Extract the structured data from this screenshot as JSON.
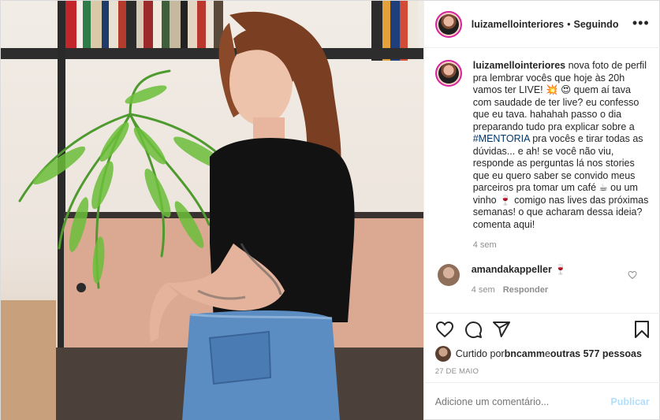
{
  "post": {
    "username": "luizamellointeriores",
    "separator": "•",
    "following_label": "Seguindo",
    "more_icon": "ellipsis-icon",
    "caption": {
      "username": "luizamellointeriores",
      "text_1": " nova foto de perfil pra lembrar vocês que hoje às 20h vamos ter LIVE! 💥 😍 quem aí tava com saudade de ter live? eu confesso que eu tava. hahahah passo o dia preparando tudo pra explicar sobre a ",
      "hashtag": "#MENTORIA",
      "text_2": " pra vocês e tirar todas as dúvidas... e ah! se você não viu, responde as perguntas lá nos stories que eu quero saber se convido meus parceiros pra tomar um café ☕ ou um vinho 🍷 comigo nas lives das próximas semanas! o que acharam dessa ideia? comenta aqui!",
      "time": "4 sem"
    },
    "comments": [
      {
        "username": "amandakappeller",
        "text": " 🍷",
        "time": "4 sem",
        "reply_label": "Responder"
      }
    ],
    "likes": {
      "prefix": "Curtido por ",
      "user": "bncamm",
      "middle": " e ",
      "others": "outras 577 pessoas"
    },
    "date": "27 DE MAIO",
    "add_comment_placeholder": "Adicione um comentário...",
    "publish_label": "Publicar",
    "icons": [
      "heart-icon",
      "comment-icon",
      "share-icon",
      "save-icon"
    ],
    "colors": {
      "link": "#00376b",
      "publish_disabled": "#b2dffc",
      "muted": "#8e8e8e"
    }
  }
}
